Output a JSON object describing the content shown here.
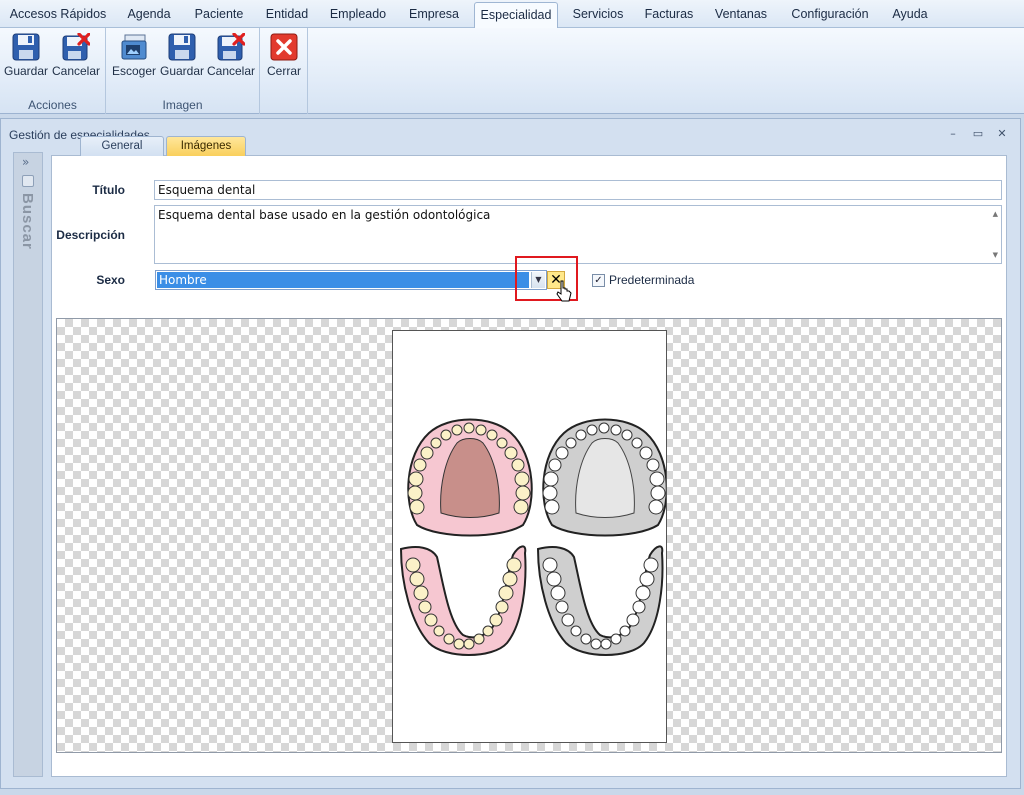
{
  "menubar": {
    "tabs": [
      {
        "label": "Accesos Rápidos",
        "active": false
      },
      {
        "label": "Agenda",
        "active": false
      },
      {
        "label": "Paciente",
        "active": false
      },
      {
        "label": "Entidad",
        "active": false
      },
      {
        "label": "Empleado",
        "active": false
      },
      {
        "label": "Empresa",
        "active": false
      },
      {
        "label": "Especialidad",
        "active": true
      },
      {
        "label": "Servicios",
        "active": false
      },
      {
        "label": "Facturas",
        "active": false
      },
      {
        "label": "Ventanas",
        "active": false
      },
      {
        "label": "Configuración",
        "active": false
      },
      {
        "label": "Ayuda",
        "active": false
      }
    ]
  },
  "ribbon": {
    "groups": [
      {
        "title": "Acciones",
        "buttons": [
          {
            "label": "Guardar",
            "icon": "save-icon"
          },
          {
            "label": "Cancelar",
            "icon": "cancel-save-icon"
          }
        ]
      },
      {
        "title": "Imagen",
        "buttons": [
          {
            "label": "Escoger",
            "icon": "choose-image-icon"
          },
          {
            "label": "Guardar",
            "icon": "save-icon"
          },
          {
            "label": "Cancelar",
            "icon": "cancel-save-icon"
          }
        ]
      },
      {
        "title": "",
        "buttons": [
          {
            "label": "Cerrar",
            "icon": "close-red-icon"
          }
        ]
      }
    ]
  },
  "window": {
    "title": "Gestión de especialidades",
    "controls": {
      "minimize": "–",
      "restore": "▭",
      "close": "✕"
    }
  },
  "side_panel": {
    "label": "Buscar",
    "chevron": "»"
  },
  "form": {
    "tabs": [
      {
        "label": "General",
        "active": false
      },
      {
        "label": "Imágenes",
        "active": true
      }
    ],
    "titulo_label": "Título",
    "titulo_value": "Esquema dental",
    "descripcion_label": "Descripción",
    "descripcion_value": "Esquema dental base usado en la gestión odontológica",
    "sexo_label": "Sexo",
    "sexo_value": "Hombre",
    "clear_symbol": "✕",
    "predeterminada_label": "Predeterminada",
    "predeterminada_checked": true
  },
  "colors": {
    "accent_selection": "#3b8ee6",
    "highlight_box": "#e0191f",
    "active_tab": "#f9cf5c"
  }
}
